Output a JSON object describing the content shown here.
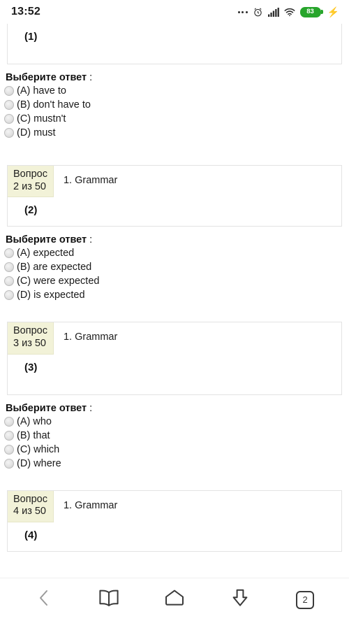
{
  "status_bar": {
    "time": "13:52",
    "icons": [
      "more-dots-icon",
      "alarm-clock-icon",
      "signal-bars-icon",
      "wifi-icon",
      "battery-icon",
      "charging-bolt-icon"
    ],
    "battery_level": "83",
    "battery_color": "#27a52b"
  },
  "answers_title": {
    "bold": "Выберите ответ",
    "suffix": " :"
  },
  "questions": [
    {
      "badge_line1": "",
      "badge_line2": "",
      "topic": "",
      "number": "(1)",
      "clipped": true,
      "options": [
        "(A) have to",
        "(B) don't have to",
        "(C) mustn't",
        "(D) must"
      ]
    },
    {
      "badge_line1": "Вопрос",
      "badge_line2": "2 из 50",
      "topic": "1. Grammar",
      "number": "(2)",
      "clipped": false,
      "options": [
        "(A) expected",
        "(B) are expected",
        "(C) were expected",
        "(D) is expected"
      ]
    },
    {
      "badge_line1": "Вопрос",
      "badge_line2": "3 из 50",
      "topic": "1. Grammar",
      "number": "(3)",
      "clipped": false,
      "options": [
        "(A) who",
        "(B) that",
        "(C) which",
        "(D) where"
      ]
    },
    {
      "badge_line1": "Вопрос",
      "badge_line2": "4 из 50",
      "topic": "1. Grammar",
      "number": "(4)",
      "clipped": false,
      "options": []
    }
  ],
  "navbar": {
    "back_label": "back-icon",
    "bookmarks_label": "book-icon",
    "home_label": "home-icon",
    "downloads_label": "download-icon",
    "tab_count": "2"
  },
  "colors": {
    "badge_bg": "#f2f2d8",
    "card_border": "#e3e3e3",
    "text": "#111111"
  }
}
